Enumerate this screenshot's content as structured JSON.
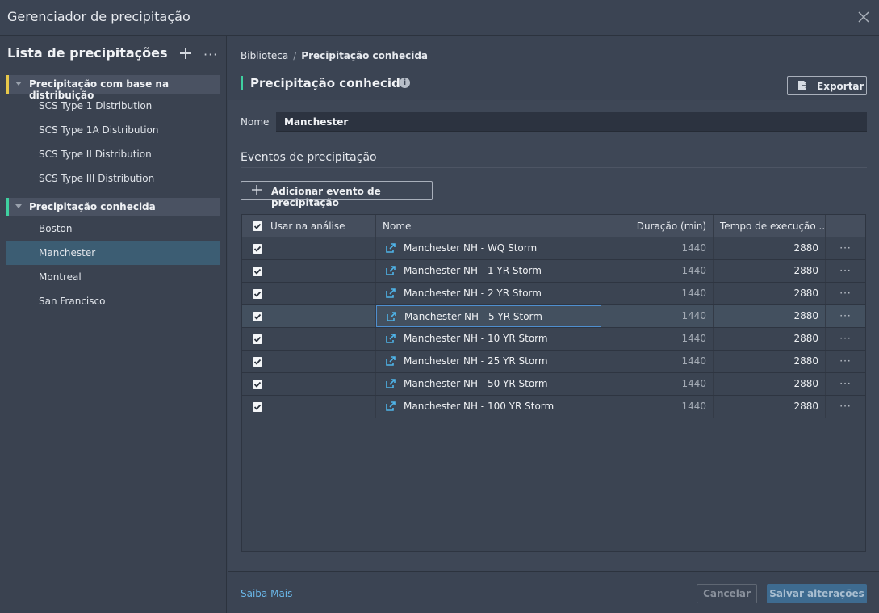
{
  "window": {
    "title": "Gerenciador de precipitação"
  },
  "sidebar": {
    "title": "Lista de precipitações",
    "more_glyph": "···",
    "groups": [
      {
        "label": "Precipitação com base na distribuição",
        "accent": "#e7c84a",
        "items": [
          "SCS Type 1 Distribution",
          "SCS Type 1A Distribution",
          "SCS Type II Distribution",
          "SCS Type III Distribution"
        ]
      },
      {
        "label": "Precipitação conhecida",
        "accent": "#3fd0a0",
        "items": [
          "Boston",
          "Manchester",
          "Montreal",
          "San Francisco"
        ]
      }
    ],
    "selected_item": "Manchester"
  },
  "header": {
    "breadcrumb_root": "Biblioteca",
    "breadcrumb_sep": "/",
    "breadcrumb_current": "Precipitação conhecida",
    "page_title": "Precipitação conhecida",
    "info_glyph": "i",
    "export_label": "Exportar"
  },
  "form": {
    "name_label": "Nome",
    "name_value": "Manchester",
    "section_title": "Eventos de precipitação",
    "add_event_label": "Adicionar evento de precipitação"
  },
  "table": {
    "columns": [
      "Usar na análise",
      "Nome",
      "Duração (min)",
      "Tempo de execução ..."
    ],
    "row_more_glyph": "···",
    "rows": [
      {
        "name": "Manchester NH - WQ Storm",
        "duration": "1440",
        "runtime": "2880",
        "checked": true
      },
      {
        "name": "Manchester NH - 1 YR Storm",
        "duration": "1440",
        "runtime": "2880",
        "checked": true
      },
      {
        "name": "Manchester NH - 2 YR Storm",
        "duration": "1440",
        "runtime": "2880",
        "checked": true
      },
      {
        "name": "Manchester NH - 5 YR Storm",
        "duration": "1440",
        "runtime": "2880",
        "checked": true
      },
      {
        "name": "Manchester NH - 10 YR Storm",
        "duration": "1440",
        "runtime": "2880",
        "checked": true
      },
      {
        "name": "Manchester NH - 25 YR Storm",
        "duration": "1440",
        "runtime": "2880",
        "checked": true
      },
      {
        "name": "Manchester NH - 50 YR Storm",
        "duration": "1440",
        "runtime": "2880",
        "checked": true
      },
      {
        "name": "Manchester NH - 100 YR Storm",
        "duration": "1440",
        "runtime": "2880",
        "checked": true
      }
    ],
    "selected_row": "Manchester NH - 5 YR Storm"
  },
  "footer": {
    "learn_more": "Saiba Mais",
    "cancel_label": "Cancelar",
    "save_label": "Salvar alterações"
  },
  "colors": {
    "link": "#6ab7e8",
    "selection": "#3c5d73",
    "primary_button": "#3e6b90"
  }
}
